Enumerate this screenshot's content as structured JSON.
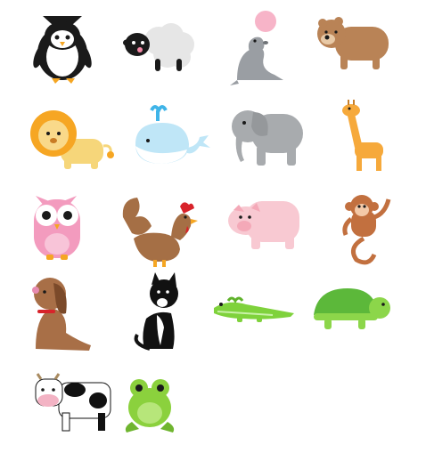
{
  "animals": [
    {
      "name": "penguin",
      "icon": "penguin-icon"
    },
    {
      "name": "sheep",
      "icon": "sheep-icon"
    },
    {
      "name": "seal",
      "icon": "seal-icon"
    },
    {
      "name": "bear",
      "icon": "bear-icon"
    },
    {
      "name": "lion",
      "icon": "lion-icon"
    },
    {
      "name": "whale",
      "icon": "whale-icon"
    },
    {
      "name": "elephant",
      "icon": "elephant-icon"
    },
    {
      "name": "giraffe",
      "icon": "giraffe-icon"
    },
    {
      "name": "owl",
      "icon": "owl-icon"
    },
    {
      "name": "rooster",
      "icon": "rooster-icon"
    },
    {
      "name": "pig",
      "icon": "pig-icon"
    },
    {
      "name": "monkey",
      "icon": "monkey-icon"
    },
    {
      "name": "dog",
      "icon": "dog-icon"
    },
    {
      "name": "cat",
      "icon": "cat-icon"
    },
    {
      "name": "crocodile",
      "icon": "crocodile-icon"
    },
    {
      "name": "turtle",
      "icon": "turtle-icon"
    },
    {
      "name": "cow",
      "icon": "cow-icon"
    },
    {
      "name": "frog",
      "icon": "frog-icon"
    }
  ],
  "colors": {
    "background": "#ffffff",
    "penguin": "#1a1a1a",
    "sheep": "#e6e6e6",
    "seal": "#9a9ea3",
    "bear": "#b98356",
    "lion": "#f6a623",
    "whale": "#bfe6f7",
    "elephant": "#a8abae",
    "giraffe": "#f6a93b",
    "owl": "#f39bbe",
    "rooster": "#a56f45",
    "pig": "#f8c9d2",
    "monkey": "#c2703f",
    "dog": "#a86f47",
    "cat": "#111111",
    "crocodile": "#7fd23c",
    "turtle": "#5cb83a",
    "cow": "#111111",
    "frog": "#8bd13d"
  }
}
